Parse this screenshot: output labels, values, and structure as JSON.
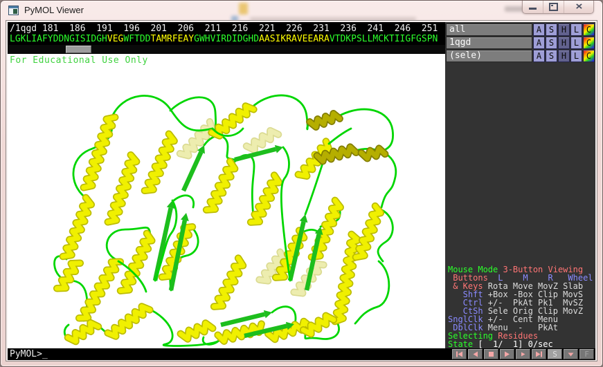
{
  "window": {
    "title": "PyMOL Viewer",
    "controls": [
      "minimize",
      "maximize",
      "close"
    ]
  },
  "sequence_bar": {
    "ruler": "/1qgd 181  186  191  196  201  206  211  216  221  226  231  236  241  246  251",
    "segments": [
      {
        "t": "LGKLIAFYDDNGISIDGH",
        "c": "green"
      },
      {
        "t": "VEG",
        "c": "yellow"
      },
      {
        "t": "WFTDD",
        "c": "green"
      },
      {
        "t": "TAMRFEAY",
        "c": "yellow"
      },
      {
        "t": "GWHVIRDIDGHD",
        "c": "green"
      },
      {
        "t": "AASIKRAVEEARA",
        "c": "yellow"
      },
      {
        "t": "VTDKPSLLMCKTIIGFGSPN",
        "c": "green"
      }
    ]
  },
  "viewport": {
    "watermark": "For Educational Use Only",
    "molecule": "1qgd"
  },
  "object_panel": {
    "rows": [
      {
        "label": "all"
      },
      {
        "label": "1qgd"
      },
      {
        "label": "(sele)"
      }
    ],
    "buttons": [
      {
        "label": "A",
        "name": "action"
      },
      {
        "label": "S",
        "name": "show"
      },
      {
        "label": "H",
        "name": "hide"
      },
      {
        "label": "L",
        "name": "label"
      },
      {
        "label": "C",
        "name": "color"
      }
    ]
  },
  "mouse_panel": {
    "lines": [
      [
        {
          "t": "Mouse Mode ",
          "c": "g"
        },
        {
          "t": "3-Button Viewing",
          "c": "r"
        }
      ],
      [
        {
          "t": " Buttons  ",
          "c": "r"
        },
        {
          "t": "L    M    R   Wheel",
          "c": "b"
        }
      ],
      [
        {
          "t": " & Keys ",
          "c": "r"
        },
        {
          "t": "Rota Move MovZ Slab",
          "c": "w"
        }
      ],
      [
        {
          "t": "   Shft ",
          "c": "b"
        },
        {
          "t": "+Box -Box Clip MovS",
          "c": "w"
        }
      ],
      [
        {
          "t": "   Ctrl ",
          "c": "b"
        },
        {
          "t": "+/-  PkAt Pk1  MvSZ",
          "c": "w"
        }
      ],
      [
        {
          "t": "   CtSh ",
          "c": "b"
        },
        {
          "t": "Sele Orig Clip MovZ",
          "c": "w"
        }
      ],
      [
        {
          "t": "SnglClk ",
          "c": "b"
        },
        {
          "t": "+/-  Cent Menu",
          "c": "w"
        }
      ],
      [
        {
          "t": " DblClk ",
          "c": "b"
        },
        {
          "t": "Menu  -   PkAt",
          "c": "w"
        }
      ],
      [
        {
          "t": "Selecting ",
          "c": "g"
        },
        {
          "t": "Residues",
          "c": "r"
        }
      ],
      [
        {
          "t": "State ",
          "c": "g"
        },
        {
          "t": "[  1/  1] 0/sec",
          "c": "W"
        }
      ]
    ]
  },
  "command_bar": {
    "prompt": "PyMOL>_"
  },
  "playback": {
    "buttons": [
      {
        "name": "skip-to-start-button",
        "icon": "skip-start"
      },
      {
        "name": "step-back-button",
        "icon": "step-back"
      },
      {
        "name": "stop-button",
        "icon": "stop"
      },
      {
        "name": "play-button",
        "icon": "play"
      },
      {
        "name": "step-forward-button",
        "icon": "step-fwd"
      },
      {
        "name": "skip-to-end-button",
        "icon": "skip-end"
      },
      {
        "name": "s-button",
        "label": "S",
        "variant": "lightbg"
      },
      {
        "name": "menu-button",
        "icon": "menu-down"
      },
      {
        "name": "f-button",
        "label": "F",
        "variant": "dim"
      }
    ]
  },
  "colors": {
    "sequence_green": "#2bff2b",
    "sequence_yellow": "#ffff00",
    "ruler_white": "#f0f0f0",
    "watermark_green": "#3fd23f",
    "mouse_green": "#2bff2b",
    "mouse_red": "#ff7575",
    "mouse_blue": "#8a8aff",
    "mouse_gray": "#dcdcdc",
    "mouse_white": "#ffffff",
    "panel_bg": "#333333",
    "panel_button_light": "#9e9ed6",
    "panel_button_dark": "#62628e",
    "helix_yellow": "#f0f000",
    "helix_yellow_dark": "#bcbc00",
    "helix_olive": "#b5ae00",
    "helix_olive_dark": "#837e00",
    "helix_pale": "#ededaf",
    "helix_pale_dark": "#dbdb93",
    "loop_green": "#00d600",
    "sheet_green": "#1dbe1d",
    "playback_pink": "#f4a7a7"
  }
}
